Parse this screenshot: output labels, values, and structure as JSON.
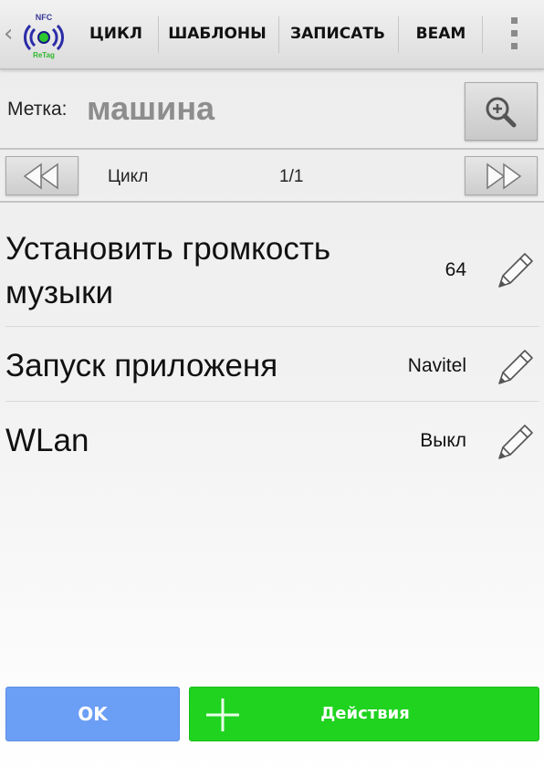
{
  "app": {
    "logo_icon": "nfc-retag-logo-icon",
    "back_icon": "back-chevron-icon"
  },
  "tabs": [
    {
      "label": "ЦИКЛ"
    },
    {
      "label": "ШАБЛОНЫ"
    },
    {
      "label": "ЗАПИСАТЬ"
    },
    {
      "label": "BEAM"
    }
  ],
  "overflow_icon": "overflow-menu-icon",
  "tag_label": {
    "key": "Метка:",
    "value": "машина",
    "search_icon": "zoom-in-icon"
  },
  "navigation": {
    "prev_icon": "rewind-icon",
    "next_icon": "fast-forward-icon",
    "label": "Цикл",
    "counter": "1/1"
  },
  "actions": [
    {
      "title_line1": "Установить громкость",
      "title_line2": "музыки",
      "value": "64",
      "edit_icon": "pencil-icon"
    },
    {
      "title_line1": "Запуск приложеня",
      "value": "Navitel",
      "edit_icon": "pencil-icon"
    },
    {
      "title_line1": "WLan",
      "value": "Выкл",
      "edit_icon": "pencil-icon"
    }
  ],
  "footer": {
    "ok_label": "OK",
    "actions_label": "Действия",
    "actions_icon": "plus-icon"
  },
  "colors": {
    "ok_button": "#6b9ef5",
    "actions_button": "#1fd31f",
    "label_value": "#8d8d8d"
  }
}
